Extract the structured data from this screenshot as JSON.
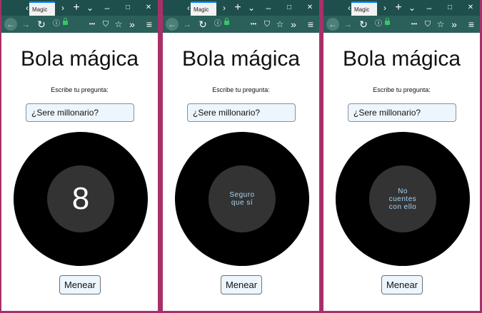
{
  "browser": {
    "tab_title": "Magic",
    "icons": {
      "tab_scroll_left": "‹",
      "tab_scroll_right": "›",
      "new_tab": "+",
      "tab_list": "⌄",
      "minimize": "–",
      "maximize": "□",
      "close": "✕",
      "back": "←",
      "forward": "→",
      "reload": "↻",
      "info": "ⓘ",
      "page_actions": "•••",
      "pocket": "⛉",
      "bookmark": "☆",
      "overflow": "»",
      "menu": "≡"
    }
  },
  "page": {
    "title": "Bola mágica",
    "prompt": "Escribe tu pregunta:",
    "question_value": "¿Sere millonario?",
    "shake_label": "Menear"
  },
  "panels": [
    {
      "answer": "8",
      "answer_style": "number"
    },
    {
      "answer": "Seguro que sí",
      "answer_style": "text"
    },
    {
      "answer": "No cuentes con ello",
      "answer_style": "text"
    }
  ],
  "colors": {
    "frame": "#a8306a",
    "tab_strip": "#1e4f4c",
    "toolbar": "#2b5f59",
    "ball": "#000000",
    "answer_window": "#333333",
    "answer_text": "#a9d3ef"
  }
}
